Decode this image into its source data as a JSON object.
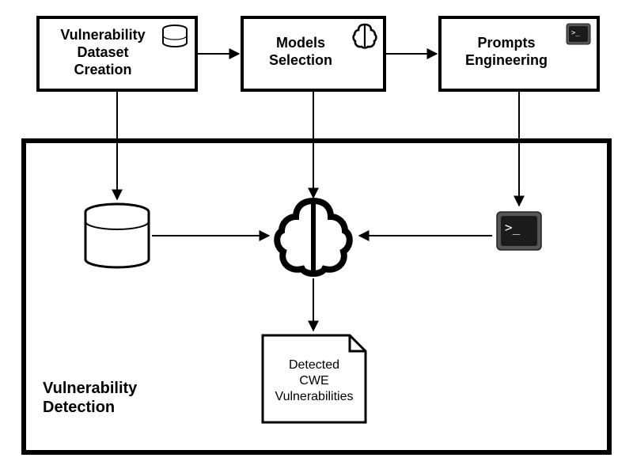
{
  "boxes": {
    "dataset": {
      "line1": "Vulnerability",
      "line2": "Dataset",
      "line3": "Creation"
    },
    "models": {
      "line1": "Models",
      "line2": "Selection"
    },
    "prompts": {
      "line1": "Prompts",
      "line2": "Engineering"
    }
  },
  "container": {
    "title": "Vulnerability",
    "title2": "Detection"
  },
  "output": {
    "line1": "Detected",
    "line2": "CWE",
    "line3": "Vulnerabilities"
  }
}
